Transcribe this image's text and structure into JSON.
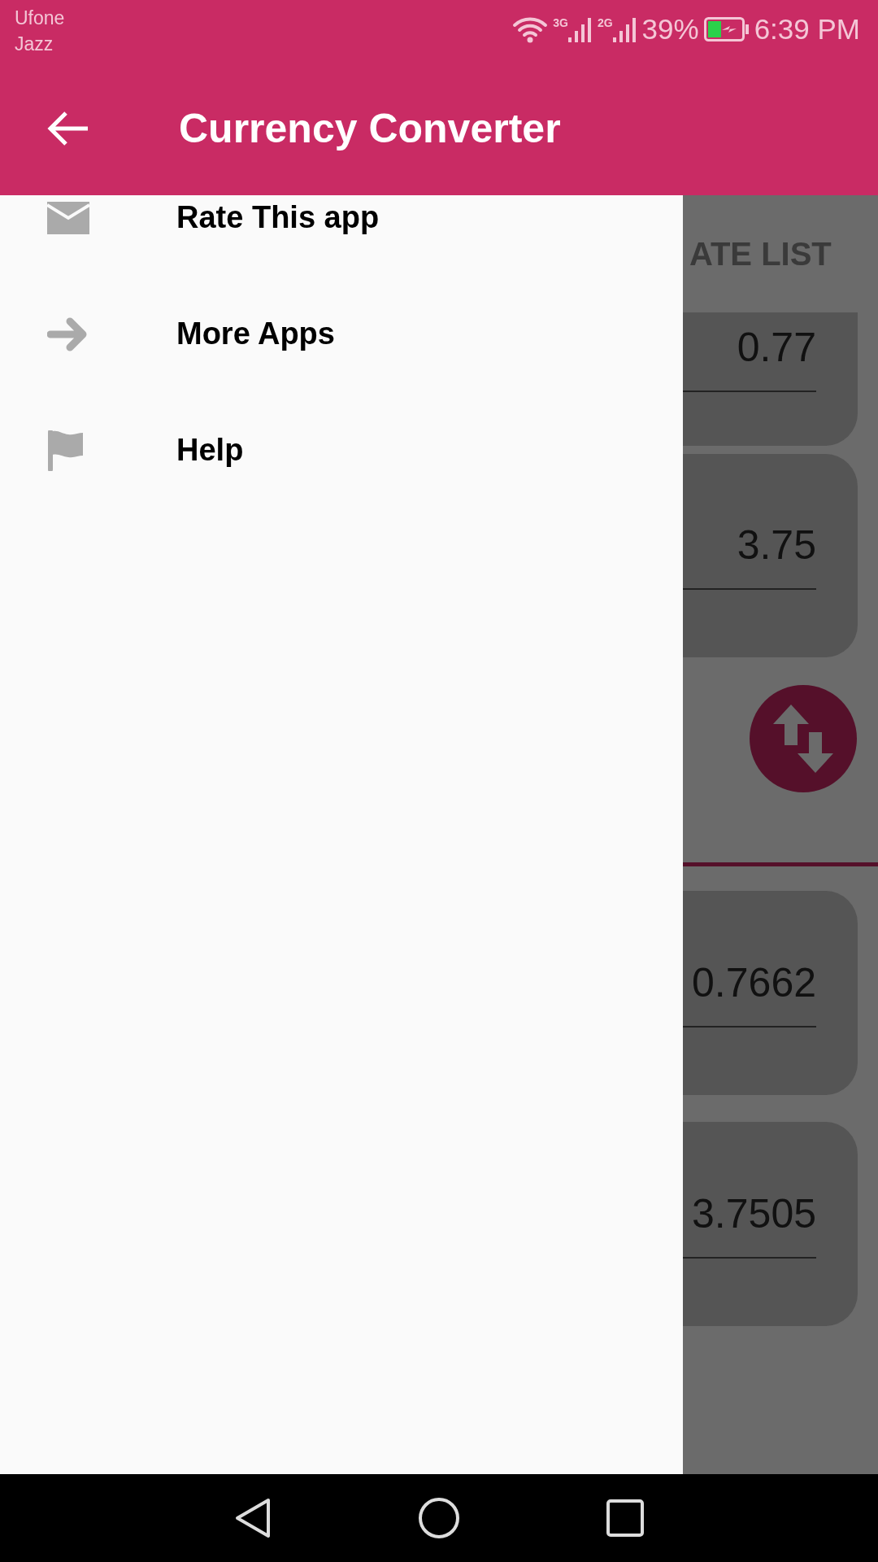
{
  "status_bar": {
    "carriers": [
      "Ufone",
      "Jazz"
    ],
    "network_labels": [
      "3G",
      "2G"
    ],
    "battery": "39%",
    "time": "6:39 PM"
  },
  "app_bar": {
    "title": "Currency Converter"
  },
  "drawer": {
    "items": [
      {
        "label": "Rate This app"
      },
      {
        "label": "More Apps"
      },
      {
        "label": "Help"
      }
    ]
  },
  "background": {
    "tab_label": "ATE LIST",
    "fields": [
      {
        "value": "0.77"
      },
      {
        "value": "3.75"
      },
      {
        "value": "0.7662"
      },
      {
        "value": "3.7505"
      }
    ]
  }
}
